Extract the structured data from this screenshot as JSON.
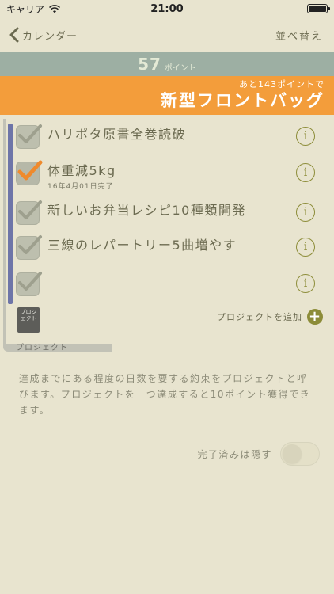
{
  "status": {
    "carrier": "キャリア",
    "time": "21:00"
  },
  "nav": {
    "back_label": "カレンダー",
    "sort_label": "並べ替え"
  },
  "points": {
    "value": "57",
    "unit": "ポイント"
  },
  "goal": {
    "remaining": "あと143ポイントで",
    "reward": "新型フロントバッグ"
  },
  "colors": {
    "orange": "#f39d3b",
    "teal": "#9dafa3",
    "accent_olive": "#8c8c38",
    "rail": "#6e75a8",
    "background": "#e8e4cf"
  },
  "projects": {
    "items": [
      {
        "title": "ハリポタ原書全巻読破",
        "done": false,
        "sub": ""
      },
      {
        "title": "体重減5kg",
        "done": true,
        "sub": "16年4月01日完了"
      },
      {
        "title": "新しいお弁当レシピ10種類開発",
        "done": false,
        "sub": ""
      },
      {
        "title": "三線のレパートリー5曲増やす",
        "done": false,
        "sub": ""
      },
      {
        "title": "",
        "done": false,
        "sub": ""
      }
    ],
    "add_label": "プロジェクトを追加",
    "icon_label": "プロジェクト",
    "section_label": "プロジェクト"
  },
  "description": "達成までにある程度の日数を要する約束をプロジェクトと呼びます。プロジェクトを一つ達成すると10ポイント獲得できます。",
  "hide_completed": {
    "label": "完了済みは隠す",
    "on": false
  },
  "icons": [
    "wifi-icon",
    "battery-icon",
    "chevron-left-icon",
    "check-icon",
    "info-icon",
    "plus-icon"
  ]
}
